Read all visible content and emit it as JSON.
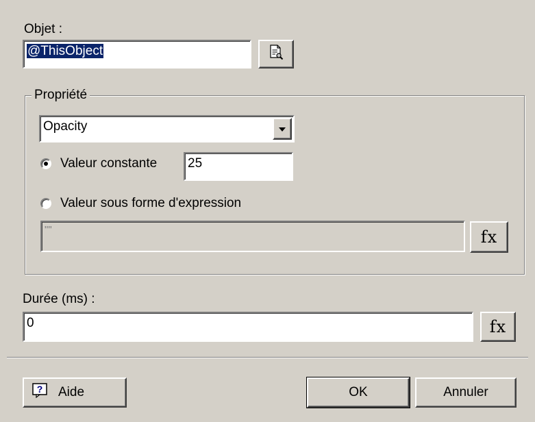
{
  "objet": {
    "label": "Objet :",
    "value": "@ThisObject",
    "browse_icon": "document-browse-icon"
  },
  "propriete": {
    "legend": "Propriété",
    "select_value": "Opacity",
    "constant_label": "Valeur constante",
    "constant_value": "25",
    "expression_label": "Valeur sous forme d'expression",
    "expression_value": "\"\"",
    "fx_label": "fx"
  },
  "duree": {
    "label": "Durée (ms) :",
    "value": "0",
    "fx_label": "fx"
  },
  "buttons": {
    "help_label": "Aide",
    "help_icon": "help-question-icon",
    "ok_label": "OK",
    "cancel_label": "Annuler"
  },
  "colors": {
    "dialog_bg": "#d4d0c8",
    "selection_bg": "#0a246a"
  }
}
